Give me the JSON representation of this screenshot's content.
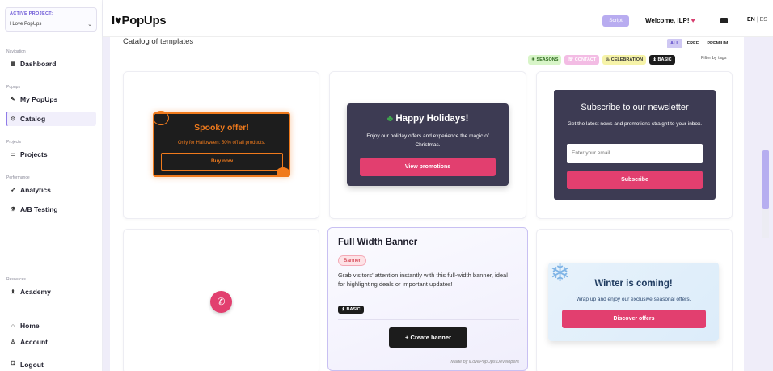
{
  "sidebar": {
    "project_label": "ACTIVE PROJECT:",
    "project_value": "I Love PopUps",
    "sections": {
      "navigation": "Navigation",
      "popups": "Popups",
      "projects": "Projects",
      "performance": "Performance",
      "resources": "Resources"
    },
    "items": {
      "dashboard": "Dashboard",
      "my_popups": "My PopUps",
      "catalog": "Catalog",
      "projects": "Projects",
      "analytics": "Analytics",
      "ab_testing": "A/B Testing",
      "academy": "Academy",
      "home": "Home",
      "account": "Account",
      "logout": "Logout"
    }
  },
  "header": {
    "logo_text": "PopUps",
    "logo_prefix": "I",
    "script_label": "Script",
    "welcome": "Welcome, ILP!",
    "lang_en": "EN",
    "lang_es": "ES"
  },
  "main": {
    "title": "Catalog of templates",
    "filter_tabs": [
      "ALL",
      "FREE",
      "PREMIUM"
    ],
    "tags": {
      "seasons": "SEASONS",
      "contact": "CONTACT",
      "celebration": "CELEBRATION",
      "basic": "BASIC"
    },
    "filter_note": "Filter by tags"
  },
  "templates": {
    "spooky": {
      "title": "Spooky offer!",
      "subtitle": "Only for Halloween: 50% off all products.",
      "button": "Buy now"
    },
    "holiday": {
      "title": "Happy Holidays!",
      "subtitle": "Enjoy our holiday offers and experience the magic of Christmas.",
      "button": "View promotions"
    },
    "newsletter": {
      "title": "Subscribe to our newsletter",
      "subtitle": "Get the latest news and promotions straight to your inbox.",
      "placeholder": "Enter your email",
      "button": "Subscribe"
    },
    "full_width_banner": {
      "title": "Full Width Banner",
      "badge": "Banner",
      "description": "Grab visitors' attention instantly with this full-width banner, ideal for highlighting deals or important updates!",
      "tag": "BASIC",
      "button": "Create banner",
      "made_by": "Made by iLovePopUps Developers"
    },
    "winter": {
      "title": "Winter is coming!",
      "subtitle": "Wrap up and enjoy our exclusive seasonal offers.",
      "button": "Discover offers"
    }
  },
  "colors": {
    "accent": "#8f7be8",
    "primary_pink": "#e23f6f",
    "halloween_orange": "#f07a1c",
    "dark_card": "#3d3b53"
  }
}
